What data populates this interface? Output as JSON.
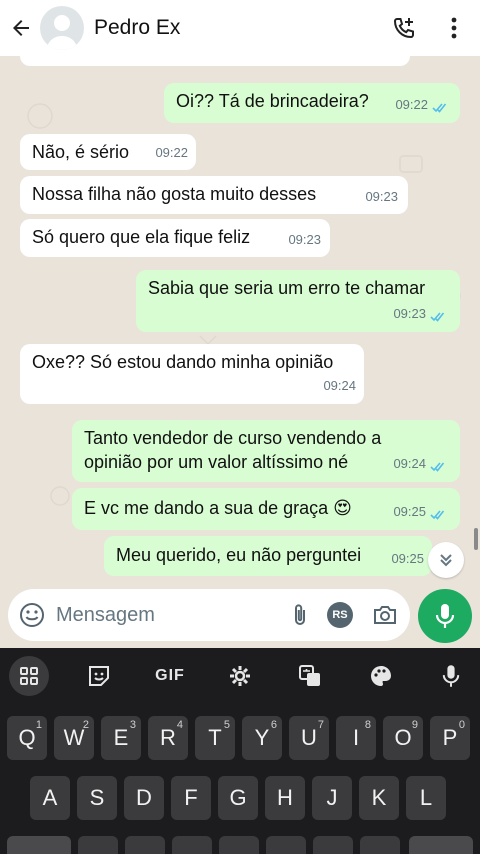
{
  "header": {
    "contact_name": "Pedro Ex"
  },
  "messages": [
    {
      "dir": "out",
      "text": "Oi?? Tá de brincadeira?",
      "time": "09:22",
      "read": true
    },
    {
      "dir": "in",
      "text": "Não, é sério",
      "time": "09:22"
    },
    {
      "dir": "in",
      "text": "Nossa filha não gosta muito desses",
      "time": "09:23"
    },
    {
      "dir": "in",
      "text": "Só quero que ela fique feliz",
      "time": "09:23"
    },
    {
      "dir": "out",
      "text": "Sabia que seria um erro te chamar",
      "time": "09:23",
      "read": true
    },
    {
      "dir": "in",
      "text": "Oxe?? Só estou dando minha opinião",
      "time": "09:24"
    },
    {
      "dir": "out",
      "text": "Tanto vendedor de curso vendendo a opinião por um valor altíssimo né",
      "line1": "Tanto vendedor de curso vendendo a",
      "line2": "opinião por um valor altíssimo né",
      "time": "09:24",
      "read": true
    },
    {
      "dir": "out",
      "text": "E vc me dando a sua de graça 😍",
      "time": "09:25",
      "read": true
    },
    {
      "dir": "out",
      "text": "Meu querido, eu não perguntei",
      "time": "09:25"
    }
  ],
  "composer": {
    "placeholder": "Mensagem",
    "sticker_badge": "RS"
  },
  "keyboard": {
    "tools": [
      "apps-grid",
      "sticker",
      "GIF",
      "settings",
      "translate",
      "palette",
      "mic"
    ],
    "gif_label": "GIF",
    "row1": [
      "Q",
      "W",
      "E",
      "R",
      "T",
      "Y",
      "U",
      "I",
      "O",
      "P"
    ],
    "row1_nums": [
      "1",
      "2",
      "3",
      "4",
      "5",
      "6",
      "7",
      "8",
      "9",
      "0"
    ],
    "row2": [
      "A",
      "S",
      "D",
      "F",
      "G",
      "H",
      "J",
      "K",
      "L"
    ]
  },
  "colors": {
    "outgoing": "#d9fdd3",
    "incoming": "#ffffff",
    "accent": "#1daa61",
    "read_ticks": "#53bdeb"
  }
}
